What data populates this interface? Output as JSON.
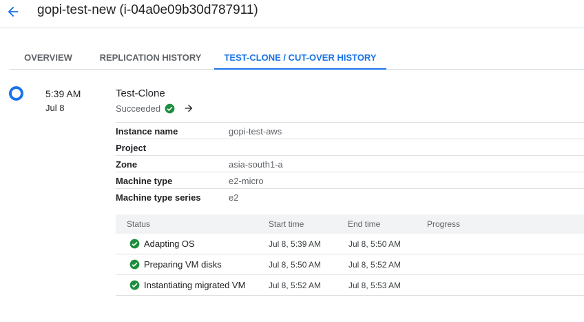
{
  "header": {
    "title": "gopi-test-new (i-04a0e09b30d787911)",
    "back_icon": "arrow-back-icon"
  },
  "tabs": [
    {
      "label": "OVERVIEW",
      "active": false
    },
    {
      "label": "REPLICATION HISTORY",
      "active": false
    },
    {
      "label": "TEST-CLONE / CUT-OVER HISTORY",
      "active": true
    }
  ],
  "event": {
    "time": "5:39 AM",
    "date": "Jul 8",
    "title": "Test-Clone",
    "status": "Succeeded",
    "status_icon": "check-circle-icon",
    "action_icon": "arrow-forward-icon"
  },
  "details": [
    {
      "label": "Instance name",
      "value": "gopi-test-aws"
    },
    {
      "label": "Project",
      "value": ""
    },
    {
      "label": "Zone",
      "value": "asia-south1-a"
    },
    {
      "label": "Machine type",
      "value": "e2-micro"
    },
    {
      "label": "Machine type series",
      "value": "e2"
    }
  ],
  "steps": {
    "columns": [
      "Status",
      "Start time",
      "End time",
      "Progress"
    ],
    "rows": [
      {
        "status": "Adapting OS",
        "start": "Jul 8, 5:39 AM",
        "end": "Jul 8, 5:50 AM"
      },
      {
        "status": "Preparing VM disks",
        "start": "Jul 8, 5:50 AM",
        "end": "Jul 8, 5:52 AM"
      },
      {
        "status": "Instantiating migrated VM",
        "start": "Jul 8, 5:52 AM",
        "end": "Jul 8, 5:53 AM"
      }
    ]
  },
  "colors": {
    "accent": "#1a73e8",
    "success": "#1e8e3e"
  }
}
